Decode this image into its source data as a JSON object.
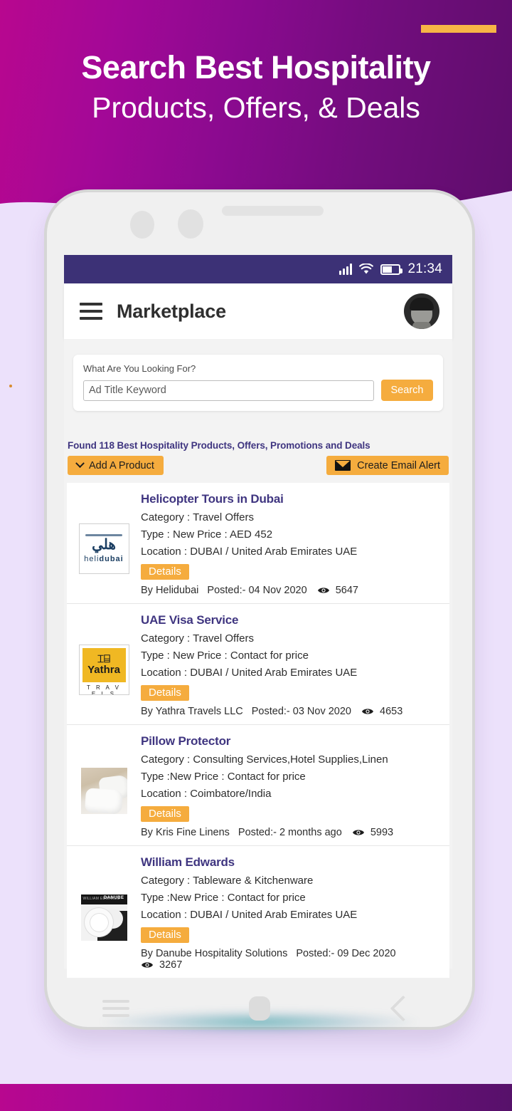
{
  "hero": {
    "line1": "Search Best Hospitality",
    "line2": "Products, Offers, & Deals"
  },
  "colors": {
    "brand_magenta": "#b8078f",
    "brand_purple": "#5d0d6b",
    "accent_orange": "#f5ac3e",
    "statusbar": "#3c3176",
    "title_indigo": "#3f3580",
    "page_lavender": "#ece1fb"
  },
  "statusbar": {
    "signal_icon": "signal-bars-icon",
    "wifi_icon": "wifi-icon",
    "battery_icon": "battery-icon",
    "time": "21:34"
  },
  "appbar": {
    "menu_icon": "hamburger-menu-icon",
    "title": "Marketplace",
    "avatar_icon": "user-avatar"
  },
  "search": {
    "label": "What Are You Looking For?",
    "placeholder": "Ad Title Keyword",
    "value": "",
    "button": "Search"
  },
  "results": {
    "found_text": "Found 118 Best Hospitality Products, Offers, Promotions and Deals",
    "add_product_button": "Add A Product",
    "add_product_icon": "chevron-down-icon",
    "email_alert_button": "Create Email Alert",
    "email_alert_icon": "envelope-icon"
  },
  "listings": [
    {
      "title": "Helicopter Tours in Dubai",
      "category": "Category : Travel Offers",
      "type_price": "Type : New   Price : AED 452",
      "location": "Location : DUBAI / United Arab Emirates UAE",
      "details_button": "Details",
      "by": "By Helidubai",
      "posted": "Posted:- 04 Nov 2020",
      "views": "5647",
      "views_icon": "eye-icon",
      "thumb": "helidubai-logo",
      "thumb_text": "helidubai"
    },
    {
      "title": "UAE Visa Service",
      "category": "Category : Travel Offers",
      "type_price": "Type : New   Price : Contact for price",
      "location": "Location : DUBAI / United Arab Emirates UAE",
      "details_button": "Details",
      "by": "By Yathra Travels LLC",
      "posted": "Posted:- 03 Nov 2020",
      "views": "4653",
      "views_icon": "eye-icon",
      "thumb": "yathra-travels-logo",
      "thumb_text": "Yathra",
      "thumb_subtext": "T R A V E L S"
    },
    {
      "title": "Pillow Protector",
      "category": "Category : Consulting Services,Hotel Supplies,Linen",
      "type_price": "Type :New    Price : Contact for price",
      "location": "Location : Coimbatore/India",
      "details_button": "Details",
      "by": "By Kris Fine Linens",
      "posted": "Posted:- 2 months ago",
      "views": "5993",
      "views_icon": "eye-icon",
      "thumb": "pillow-photo"
    },
    {
      "title": "William Edwards",
      "category": "Category : Tableware & Kitchenware",
      "type_price": "Type :New    Price : Contact for price",
      "location": "Location :  DUBAI / United Arab Emirates UAE",
      "details_button": "Details",
      "by": "By Danube Hospitality Solutions",
      "posted": "Posted:- 09 Dec 2020",
      "views": "3267",
      "views_icon": "eye-icon",
      "thumb": "tableware-photo"
    }
  ],
  "phone_nav": {
    "recent_icon": "recent-apps-icon",
    "home_icon": "home-icon",
    "back_icon": "back-chevron-icon"
  }
}
